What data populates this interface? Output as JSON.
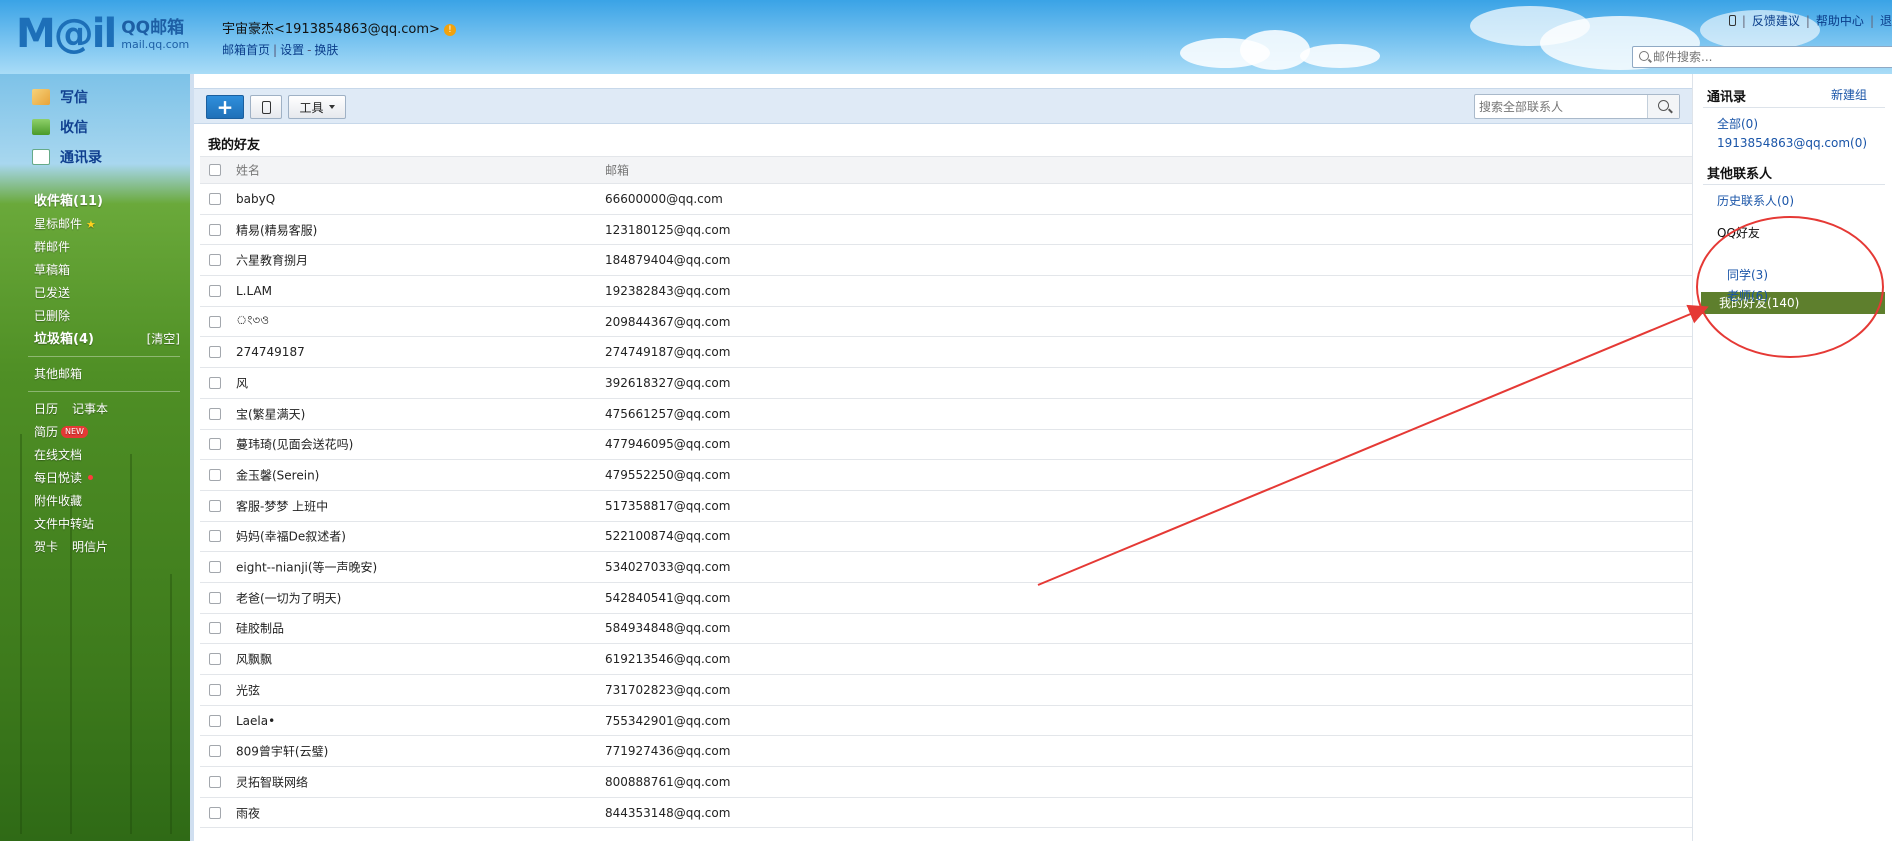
{
  "header": {
    "logo_mark": "M@il",
    "logo_title": "QQ邮箱",
    "logo_domain": "mail.qq.com",
    "account_name": "宇宙豪杰<1913854863@qq.com>",
    "warn_icon": "!",
    "links": [
      "邮箱首页",
      "设置",
      "换肤"
    ],
    "top_links": [
      "反馈建议",
      "帮助中心",
      "退"
    ],
    "search_placeholder": "邮件搜索..."
  },
  "sidebar": {
    "main_nav": [
      {
        "label": "写信",
        "icon": "compose-icon"
      },
      {
        "label": "收信",
        "icon": "inbox-icon"
      },
      {
        "label": "通讯录",
        "icon": "contacts-icon"
      }
    ],
    "folders_group1": [
      {
        "label": "收件箱(11)",
        "bold": true
      },
      {
        "label": "星标邮件",
        "star": "★"
      },
      {
        "label": "群邮件"
      },
      {
        "label": "草稿箱"
      },
      {
        "label": "已发送"
      },
      {
        "label": "已删除"
      },
      {
        "label": "垃圾箱(4)",
        "bold": true,
        "action": "[清空]"
      }
    ],
    "other_mailbox": "其他邮箱",
    "tools": [
      {
        "label": "日历",
        "second": "记事本"
      },
      {
        "label": "简历",
        "badge": "NEW"
      },
      {
        "label": "在线文档"
      },
      {
        "label": "每日悦读",
        "dot": true
      },
      {
        "label": "附件收藏"
      },
      {
        "label": "文件中转站"
      },
      {
        "label": "贺卡",
        "second": "明信片"
      }
    ]
  },
  "toolbar": {
    "add_label": "+",
    "tools_label": "工具",
    "search_placeholder": "搜索全部联系人"
  },
  "contacts": {
    "group_title": "我的好友",
    "col_name": "姓名",
    "col_email": "邮箱",
    "rows": [
      {
        "name": "babyQ",
        "email": "66600000@qq.com"
      },
      {
        "name": "精易(精易客服)",
        "email": "123180125@qq.com"
      },
      {
        "name": "六星教育捌月",
        "email": "184879404@qq.com"
      },
      {
        "name": "L.LAM",
        "email": "192382843@qq.com"
      },
      {
        "name": "ং৩ও",
        "email": "209844367@qq.com"
      },
      {
        "name": "274749187",
        "email": "274749187@qq.com"
      },
      {
        "name": "风",
        "email": "392618327@qq.com"
      },
      {
        "name": "宝(繁星满天)",
        "email": "475661257@qq.com"
      },
      {
        "name": "蔓玮琦(见面会送花吗)",
        "email": "477946095@qq.com"
      },
      {
        "name": "金玉馨(Serein)",
        "email": "479552250@qq.com"
      },
      {
        "name": "客服-梦梦 上班中",
        "email": "517358817@qq.com"
      },
      {
        "name": "妈妈(幸福De叙述者)",
        "email": "522100874@qq.com"
      },
      {
        "name": "eight--nianji(等一声晚安)",
        "email": "534027033@qq.com"
      },
      {
        "name": "老爸(一切为了明天)",
        "email": "542840541@qq.com"
      },
      {
        "name": "硅胶制品",
        "email": "584934848@qq.com"
      },
      {
        "name": "风飘飘",
        "email": "619213546@qq.com"
      },
      {
        "name": "光弦",
        "email": "731702823@qq.com"
      },
      {
        "name": "Laela•",
        "email": "755342901@qq.com"
      },
      {
        "name": "809曾宇轩(云璧)",
        "email": "771927436@qq.com"
      },
      {
        "name": "灵拓智联网络",
        "email": "800888761@qq.com"
      },
      {
        "name": "雨夜",
        "email": "844353148@qq.com"
      }
    ]
  },
  "right_panel": {
    "title": "通讯录",
    "new_group": "新建组",
    "all": "全部(0)",
    "own_address": "1913854863@qq.com(0)",
    "other_title": "其他联系人",
    "history": "历史联系人(0)",
    "qq_friends": "QQ好友",
    "my_friends": "我的好友(140)",
    "classmates": "同学(3)",
    "teachers": "老师(6)"
  },
  "colors": {
    "accent_blue": "#1f70b8",
    "selected_group": "#5e7f2d",
    "annotation_red": "#e53935"
  }
}
